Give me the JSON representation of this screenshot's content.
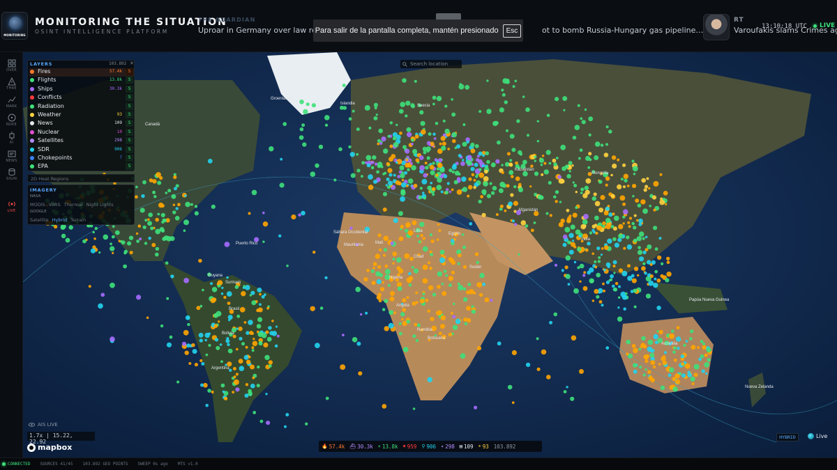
{
  "header": {
    "logo_text": "MONITORING",
    "title": "MONITORING THE SITUATION",
    "subtitle": "OSINT INTELLIGENCE PLATFORM",
    "ticker_source": "THE GUARDIAN",
    "ticker_headline_left": "Uproar in Germany over law requi",
    "ticker_headline_right": "ot to bomb Russia-Hungary gas pipeline…",
    "avatar_source": "RT",
    "avatar_headline": "Varoufakis slams Crimes age",
    "clock": "13:10:18 UTC",
    "live_label": "LIVE"
  },
  "fullscreen_notice": {
    "text": "Para salir de la pantalla completa, mantén presionado",
    "key": "Esc"
  },
  "nav": [
    {
      "label": "OVER",
      "icon": "grid-icon"
    },
    {
      "label": "THRE",
      "icon": "warning-icon"
    },
    {
      "label": "MARK",
      "icon": "trend-icon"
    },
    {
      "label": "NUKE",
      "icon": "radiation-icon"
    },
    {
      "label": "AI",
      "icon": "chip-icon"
    },
    {
      "label": "NEWS",
      "icon": "news-icon"
    },
    {
      "label": "SIGIN",
      "icon": "database-icon"
    },
    {
      "label": "LIVE",
      "icon": "broadcast-icon"
    }
  ],
  "layers": {
    "title": "LAYERS",
    "count": "103.892",
    "items": [
      {
        "name": "Fires",
        "count": "57.4k",
        "color": "#ff7a2e",
        "toggle": "S"
      },
      {
        "name": "Flights",
        "count": "13.8k",
        "color": "#3ee07b",
        "toggle": "S"
      },
      {
        "name": "Ships",
        "count": "30.3k",
        "color": "#a66bff",
        "toggle": "S"
      },
      {
        "name": "Conflicts",
        "count": "",
        "color": "#ff3b3b",
        "toggle": "S"
      },
      {
        "name": "Radiation",
        "count": "",
        "color": "#3ee07b",
        "toggle": "S"
      },
      {
        "name": "Weather",
        "count": "93",
        "color": "#ffd23f",
        "toggle": "S"
      },
      {
        "name": "News",
        "count": "109",
        "color": "#e5e9ee",
        "toggle": "S"
      },
      {
        "name": "Nuclear",
        "count": "10",
        "color": "#e04fd2",
        "toggle": "S"
      },
      {
        "name": "Satellites",
        "count": "298",
        "color": "#b58cff",
        "toggle": "S"
      },
      {
        "name": "SDR",
        "count": "906",
        "color": "#22d3ee",
        "toggle": "S"
      },
      {
        "name": "Chokepoints",
        "count": "7",
        "color": "#3b82f6",
        "toggle": "S"
      },
      {
        "name": "EPA",
        "count": "",
        "color": "#3ee07b",
        "toggle": "S"
      }
    ],
    "heat_regions_label": "2D Heat Regions"
  },
  "imagery": {
    "title": "IMAGERY",
    "nasa_label": "NASA",
    "options": [
      "MODIS",
      "VIIRS",
      "Thermal",
      "Night Lights"
    ],
    "google_label": "GOOGLE",
    "modes": [
      "Satellite",
      "Hybrid",
      "Terrain"
    ],
    "selected_mode": "Hybrid"
  },
  "search": {
    "placeholder": "Search location"
  },
  "map_labels": [
    "Groenlandia",
    "Islandia",
    "Suecia",
    "Canadá",
    "Kazajistán",
    "Mongolia",
    "Afganistán",
    "India",
    "Chad",
    "Egipto",
    "Sudán",
    "Nigeria",
    "Namibia",
    "Botsuana",
    "Brasil",
    "Bolivia",
    "Guyana",
    "Surinam",
    "Puerto Rico",
    "Argentina",
    "Australia",
    "Papúa Nueva Guinea",
    "Nueva Zelanda",
    "Sáhara Occidental",
    "Mauritania",
    "Mali",
    "Libia",
    "Angola"
  ],
  "ais": {
    "label": "AIS LIVE"
  },
  "map_readout": {
    "zoom": "1.7x",
    "coords": "15.22, 22.92"
  },
  "mapbox_label": "mapbox",
  "stats": [
    {
      "icon": "fire-icon",
      "glyph": "🔥",
      "value": "57.4k",
      "color": "#ff7a2e"
    },
    {
      "icon": "ship-icon",
      "glyph": "⛴",
      "value": "30.3k",
      "color": "#b58cff"
    },
    {
      "icon": "plane-icon",
      "glyph": "✈",
      "value": "13.8k",
      "color": "#3ee07b"
    },
    {
      "icon": "conflict-icon",
      "glyph": "✖",
      "value": "959",
      "color": "#ff3b3b"
    },
    {
      "icon": "antenna-icon",
      "glyph": "⚲",
      "value": "906",
      "color": "#22d3ee"
    },
    {
      "icon": "satellite-icon",
      "glyph": "✦",
      "value": "298",
      "color": "#b58cff"
    },
    {
      "icon": "news-icon",
      "glyph": "▤",
      "value": "109",
      "color": "#e5e9ee"
    },
    {
      "icon": "weather-icon",
      "glyph": "☀",
      "value": "93",
      "color": "#ffd23f"
    },
    {
      "icon": "total-icon",
      "glyph": "",
      "value": "103.892",
      "color": "#8c96a2"
    }
  ],
  "map_mode": {
    "label": "HYBRID",
    "live": "Live"
  },
  "statusbar": {
    "connected": "CONNECTED",
    "sources": "SOURCES 41/45",
    "geo_points": "103.892 GEO POINTS",
    "sweep": "SWEEP 0s ago",
    "version": "MTS v1.0"
  },
  "colors": {
    "fires": "#ffa500",
    "flights": "#3ee07b",
    "ships": "#a66bff",
    "sdr": "#22d3ee",
    "ocean": "#0e2648",
    "land": "#3b4a3a",
    "desert": "#b58a5c"
  }
}
